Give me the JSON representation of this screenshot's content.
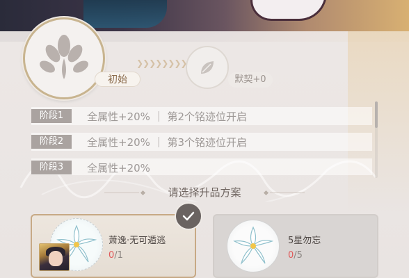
{
  "header": {
    "stage_current_label": "初始",
    "bond_label": "默契+0"
  },
  "stages": [
    {
      "tag": "阶段1",
      "desc": "全属性+20%  ｜ 第2个铭迹位开启"
    },
    {
      "tag": "阶段2",
      "desc": "全属性+20%  ｜ 第3个铭迹位开启"
    },
    {
      "tag": "阶段3",
      "desc": "全属性+20%"
    }
  ],
  "section_title": "请选择升品方案",
  "options": [
    {
      "name": "萧逸·无可遁逃",
      "count_current": "0",
      "count_total": "/1",
      "selected": true
    },
    {
      "name": "5星勿忘",
      "count_current": "0",
      "count_total": "/5",
      "selected": false
    }
  ],
  "colors": {
    "accent_gold": "#c7a985",
    "count_red": "#e05a5a",
    "tag_gray": "#aaa3a0"
  },
  "icons": {
    "medallion": "lily-emblem-icon",
    "bond": "leaf-icon",
    "selected": "checkmark-icon",
    "material": "white-lily-icon"
  }
}
